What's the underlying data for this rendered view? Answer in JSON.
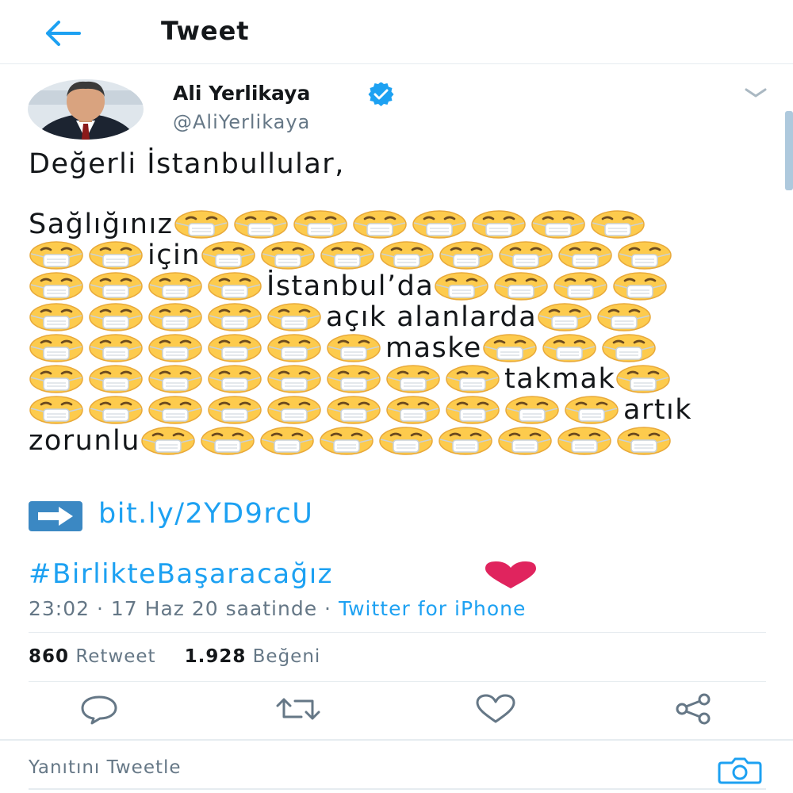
{
  "header": {
    "title": "Tweet",
    "back_icon": "arrow-left-icon"
  },
  "tweet": {
    "author": {
      "name": "Ali Yerlikaya",
      "handle": "@AliYerlikaya",
      "verified": true
    },
    "text": {
      "greeting": "Değerli İstanbullular,",
      "words": [
        "Sağlığınız",
        "için",
        "İstanbul’da",
        "açık alanlarda",
        "maske",
        "takmak",
        "artık",
        "zorunlu"
      ],
      "emoji": "face-with-medical-mask"
    },
    "link": {
      "icon": "right-arrow-emoji",
      "text": "bit.ly/2YD9rcU"
    },
    "hashtag": "#BirlikteBaşaracağız",
    "hashtag_emoji": "red-heart-emoji",
    "meta": {
      "time": "23:02",
      "sep": " · ",
      "date": "17 Haz 20 saatinde",
      "source": "Twitter for iPhone"
    },
    "stats": {
      "retweets": {
        "count": "860",
        "label": "Retweet"
      },
      "likes": {
        "count": "1.928",
        "label": "Beğeni"
      }
    }
  },
  "actions": [
    "reply-icon",
    "retweet-icon",
    "like-icon",
    "share-icon"
  ],
  "reply": {
    "placeholder": "Yanıtını Tweetle",
    "camera_icon": "camera-icon"
  },
  "colors": {
    "link": "#1da1f2",
    "secondary_text": "#657786",
    "divider": "#e6ecf0",
    "verified": "#1da1f2",
    "heart": "#e0245e",
    "emoji_face": "#fdcb4d"
  }
}
